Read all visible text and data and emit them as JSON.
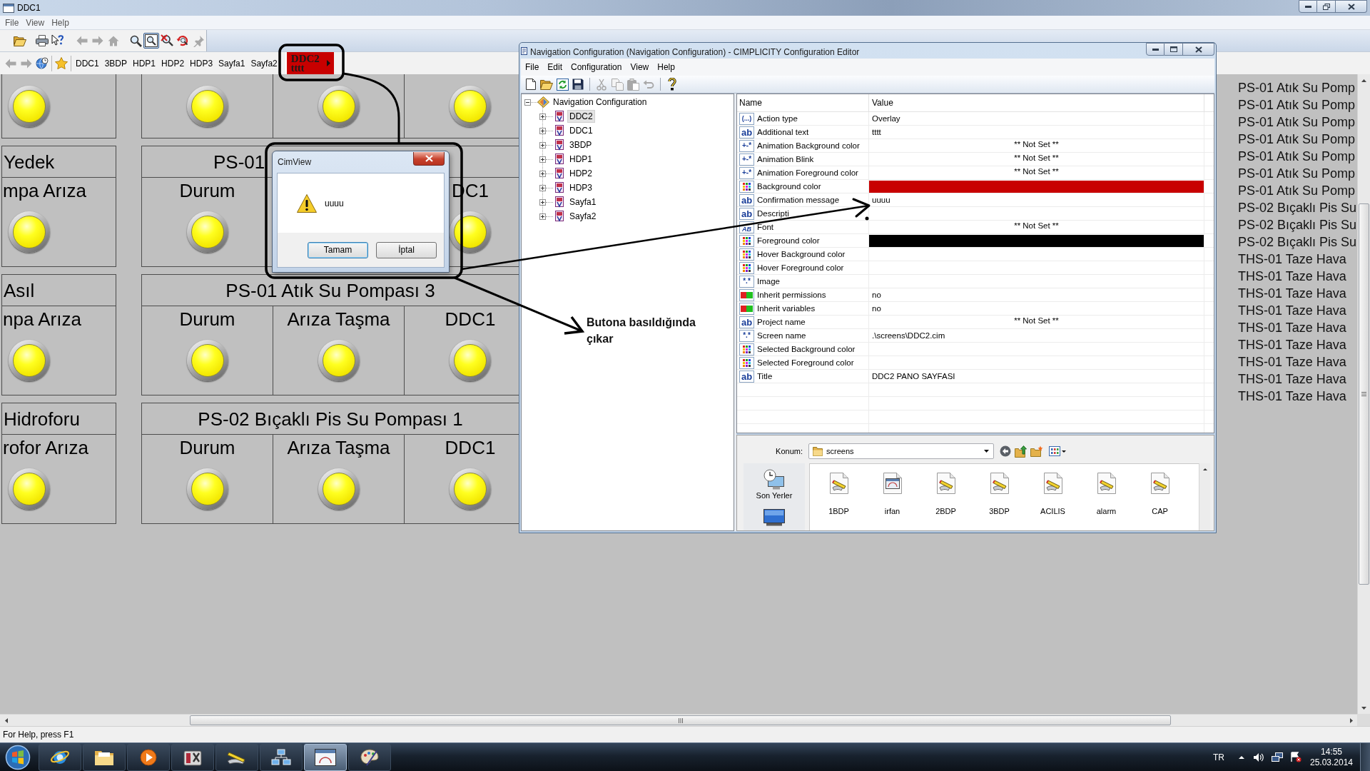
{
  "main_window": {
    "title": "DDC1",
    "menu": [
      "File",
      "View",
      "Help"
    ],
    "toolbar": [
      [
        {
          "kind": "open",
          "disabled": false,
          "pressed": false
        }
      ],
      [
        {
          "kind": "print",
          "disabled": false,
          "pressed": false
        },
        {
          "kind": "context_help",
          "disabled": false,
          "pressed": false
        }
      ],
      [
        {
          "kind": "back",
          "disabled": true,
          "pressed": false
        },
        {
          "kind": "forward",
          "disabled": true,
          "pressed": false
        },
        {
          "kind": "home",
          "disabled": true,
          "pressed": false
        }
      ],
      [
        {
          "kind": "zoom",
          "disabled": false,
          "pressed": false
        },
        {
          "kind": "zoom_box",
          "disabled": false,
          "pressed": true
        },
        {
          "kind": "zoom_fit",
          "disabled": false,
          "pressed": false
        },
        {
          "kind": "zoom_reset",
          "disabled": false,
          "pressed": false
        },
        {
          "kind": "pin",
          "disabled": true,
          "pressed": false
        }
      ]
    ],
    "nav_bar": {
      "tools": [
        [
          {
            "kind": "back",
            "disabled": true
          },
          {
            "kind": "forward",
            "disabled": true
          },
          {
            "kind": "globe",
            "disabled": false
          }
        ],
        [
          {
            "kind": "star",
            "disabled": false
          }
        ]
      ],
      "links": [
        {
          "kind": "link",
          "label": "DDC1"
        },
        {
          "kind": "link",
          "label": "3BDP"
        },
        {
          "kind": "link",
          "label": "HDP1"
        },
        {
          "kind": "link",
          "label": "HDP2"
        },
        {
          "kind": "link",
          "label": "HDP3"
        },
        {
          "kind": "link",
          "label": "Sayfa1"
        },
        {
          "kind": "link",
          "label": "Sayfa2"
        },
        {
          "kind": "menu",
          "label": "DDC2",
          "sublabel": "tttt",
          "color": "#c80000"
        }
      ]
    },
    "hmi": {
      "left_column": [
        {
          "cells": [
            {
              "kind": "lamp"
            }
          ]
        },
        {
          "header": "Yedek",
          "cells": [
            {
              "kind": "lamp",
              "label": "mpa Arıza"
            }
          ]
        },
        {
          "header": "Asıl",
          "cells": [
            {
              "kind": "lamp",
              "label": "npa Arıza"
            }
          ]
        },
        {
          "header": "Hidroforu",
          "cells": [
            {
              "kind": "lamp",
              "label": "rofor Arıza"
            }
          ]
        }
      ],
      "main_group": [
        {
          "cells": [
            {
              "kind": "lamp"
            },
            {
              "kind": "lamp"
            },
            {
              "kind": "lamp"
            }
          ]
        },
        {
          "header": "PS-01",
          "covered": true,
          "cells": [
            {
              "kind": "lamp",
              "label": "Durum"
            },
            {
              "kind": "empty"
            },
            {
              "kind": "lamp",
              "label": "DC1"
            }
          ]
        },
        {
          "header": "PS-01 Atık Su Pompası 3",
          "covered": false,
          "cells": [
            {
              "kind": "lamp",
              "label": "Durum"
            },
            {
              "kind": "lamp",
              "label": "Arıza Taşma"
            },
            {
              "kind": "lamp",
              "label": "DDC1"
            }
          ]
        },
        {
          "header": "PS-02 Bıçaklı Pis Su Pompası 1",
          "covered": false,
          "cells": [
            {
              "kind": "lamp",
              "label": "Durum"
            },
            {
              "kind": "lamp",
              "label": "Arıza Taşma"
            },
            {
              "kind": "lamp",
              "label": "DDC1"
            }
          ]
        }
      ],
      "side_list": [
        "PS-01 Atık Su Pomp",
        "PS-01 Atık Su Pomp",
        "PS-01 Atık Su Pomp",
        "PS-01 Atık Su Pomp",
        "PS-01 Atık Su Pomp",
        "PS-01 Atık Su Pomp",
        "PS-01 Atık Su Pomp",
        "PS-02 Bıçaklı Pis Su",
        "PS-02 Bıçaklı Pis Su",
        "PS-02 Bıçaklı Pis Su",
        "THS-01 Taze Hava",
        "THS-01 Taze Hava",
        "THS-01 Taze Hava",
        "THS-01 Taze Hava",
        "THS-01 Taze Hava",
        "THS-01 Taze Hava",
        "THS-01 Taze Hava",
        "THS-01 Taze Hava",
        "THS-01 Taze Hava"
      ]
    },
    "status_bar": "For Help, press F1"
  },
  "config_editor": {
    "title": "Navigation Configuration (Navigation Configuration) - CIMPLICITY Configuration Editor",
    "menu": [
      "File",
      "Edit",
      "Configuration",
      "View",
      "Help"
    ],
    "toolbar": [
      [
        {
          "kind": "new",
          "disabled": false
        },
        {
          "kind": "open",
          "disabled": false
        },
        {
          "kind": "refresh",
          "disabled": false
        },
        {
          "kind": "save",
          "disabled": false
        }
      ],
      [
        {
          "kind": "cut",
          "disabled": true
        },
        {
          "kind": "copy",
          "disabled": true
        },
        {
          "kind": "paste",
          "disabled": true
        },
        {
          "kind": "undo",
          "disabled": true
        }
      ],
      [
        {
          "kind": "help",
          "disabled": false
        }
      ]
    ],
    "tree": {
      "label": "Navigation Configuration",
      "expanded": true,
      "selected": false,
      "children": [
        {
          "label": "DDC2",
          "expanded": false,
          "selected": true
        },
        {
          "label": "DDC1",
          "expanded": false,
          "selected": false
        },
        {
          "label": "3BDP",
          "expanded": false,
          "selected": false
        },
        {
          "label": "HDP1",
          "expanded": false,
          "selected": false
        },
        {
          "label": "HDP2",
          "expanded": false,
          "selected": false
        },
        {
          "label": "HDP3",
          "expanded": false,
          "selected": false
        },
        {
          "label": "Sayfa1",
          "expanded": false,
          "selected": false
        },
        {
          "label": "Sayfa2",
          "expanded": false,
          "selected": false
        }
      ]
    },
    "properties": {
      "columns": [
        "Name",
        "Value"
      ],
      "rows": [
        {
          "kind": "enum",
          "icon": "(...)",
          "name": "Action type",
          "value": "Overlay"
        },
        {
          "kind": "text",
          "icon": "ab",
          "name": "Additional text",
          "value": "tttt"
        },
        {
          "kind": "expression",
          "icon": "+-*",
          "name": "Animation Background color",
          "placeholder": "** Not Set **"
        },
        {
          "kind": "expression",
          "icon": "+-*",
          "name": "Animation Blink",
          "placeholder": "** Not Set **"
        },
        {
          "kind": "expression",
          "icon": "+-*",
          "name": "Animation Foreground color",
          "placeholder": "** Not Set **"
        },
        {
          "kind": "color",
          "name": "Background color",
          "color": "#c80000"
        },
        {
          "kind": "text",
          "icon": "ab",
          "name": "Confirmation message",
          "value": "uuuu"
        },
        {
          "kind": "text",
          "icon": "ab",
          "name": "Descripti"
        },
        {
          "kind": "font",
          "icon": "AB",
          "name": "Font",
          "placeholder": "** Not Set **"
        },
        {
          "kind": "color",
          "name": "Foreground color",
          "color": "#000000"
        },
        {
          "kind": "color",
          "name": "Hover Background color"
        },
        {
          "kind": "color",
          "name": "Hover Foreground color"
        },
        {
          "kind": "file",
          "icon": "*.*",
          "name": "Image"
        },
        {
          "kind": "boolean",
          "name": "Inherit permissions",
          "value": "no"
        },
        {
          "kind": "boolean",
          "name": "Inherit variables",
          "value": "no"
        },
        {
          "kind": "text",
          "icon": "ab",
          "name": "Project name",
          "placeholder": "** Not Set **"
        },
        {
          "kind": "file",
          "icon": "*.*",
          "name": "Screen name",
          "value": ".\\screens\\DDC2.cim"
        },
        {
          "kind": "color",
          "name": "Selected Background color"
        },
        {
          "kind": "color",
          "name": "Selected Foreground color"
        },
        {
          "kind": "text",
          "icon": "ab",
          "name": "Title",
          "value": "DDC2 PANO SAYFASI"
        }
      ]
    },
    "file_browser": {
      "location_label": "Konum:",
      "location": "screens",
      "places": [
        {
          "kind": "recent",
          "label": "Son Yerler"
        },
        {
          "kind": "desktop"
        }
      ],
      "files": [
        {
          "kind": "drawing",
          "name": "1BDP"
        },
        {
          "kind": "panel",
          "name": "irfan"
        },
        {
          "kind": "drawing",
          "name": "2BDP"
        },
        {
          "kind": "drawing",
          "name": "3BDP"
        },
        {
          "kind": "drawing",
          "name": "ACILIS"
        },
        {
          "kind": "drawing",
          "name": "alarm"
        },
        {
          "kind": "drawing",
          "name": "CAP"
        }
      ]
    }
  },
  "dialog": {
    "title": "CimView",
    "message": "uuuu",
    "buttons": [
      {
        "label": "Tamam",
        "default": true
      },
      {
        "label": "İptal",
        "default": false
      }
    ]
  },
  "annotation": {
    "note": "Butona basıldığında çıkar"
  },
  "taskbar": {
    "items": [
      {
        "kind": "browser",
        "active": false
      },
      {
        "kind": "explorer",
        "active": false
      },
      {
        "kind": "media",
        "active": false
      },
      {
        "kind": "tools",
        "active": false
      },
      {
        "kind": "pencil",
        "active": false
      },
      {
        "kind": "network",
        "active": false
      },
      {
        "kind": "window",
        "active": true
      },
      {
        "kind": "paint",
        "active": false
      }
    ],
    "language": "TR",
    "time": "14:55",
    "date": "25.03.2014"
  }
}
